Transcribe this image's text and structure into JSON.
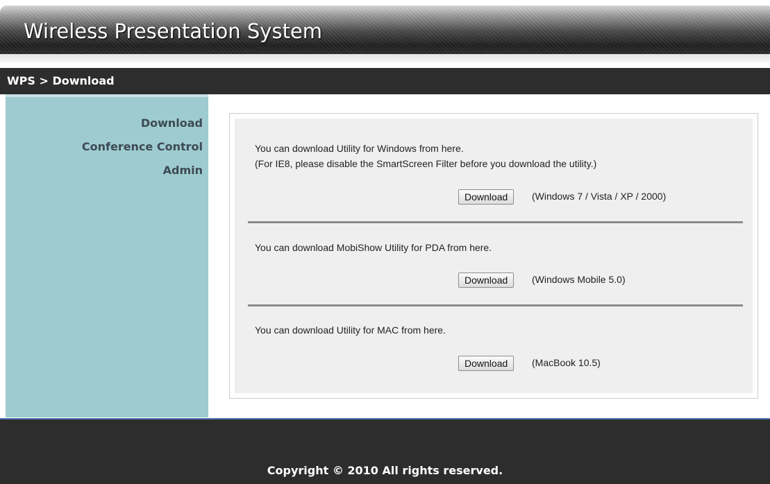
{
  "header": {
    "title": "Wireless Presentation System"
  },
  "breadcrumb": "WPS > Download",
  "sidebar": {
    "items": [
      {
        "label": "Download"
      },
      {
        "label": "Conference Control"
      },
      {
        "label": "Admin"
      }
    ]
  },
  "sections": [
    {
      "lines": [
        "You can download Utility for Windows from here.",
        "(For IE8, please disable the SmartScreen Filter before you download the utility.)"
      ],
      "button": "Download",
      "platform": "(Windows 7 / Vista / XP / 2000)"
    },
    {
      "lines": [
        "You can download MobiShow Utility for PDA from here."
      ],
      "button": "Download",
      "platform": "(Windows Mobile 5.0)"
    },
    {
      "lines": [
        "You can download Utility for MAC from here."
      ],
      "button": "Download",
      "platform": "(MacBook 10.5)"
    }
  ],
  "footer": {
    "copyright": "Copyright © 2010 All rights reserved."
  },
  "colors": {
    "sidebar_bg": "#9ecbcf",
    "bar_bg": "#2d2d2d",
    "panel_bg": "#efefef"
  }
}
